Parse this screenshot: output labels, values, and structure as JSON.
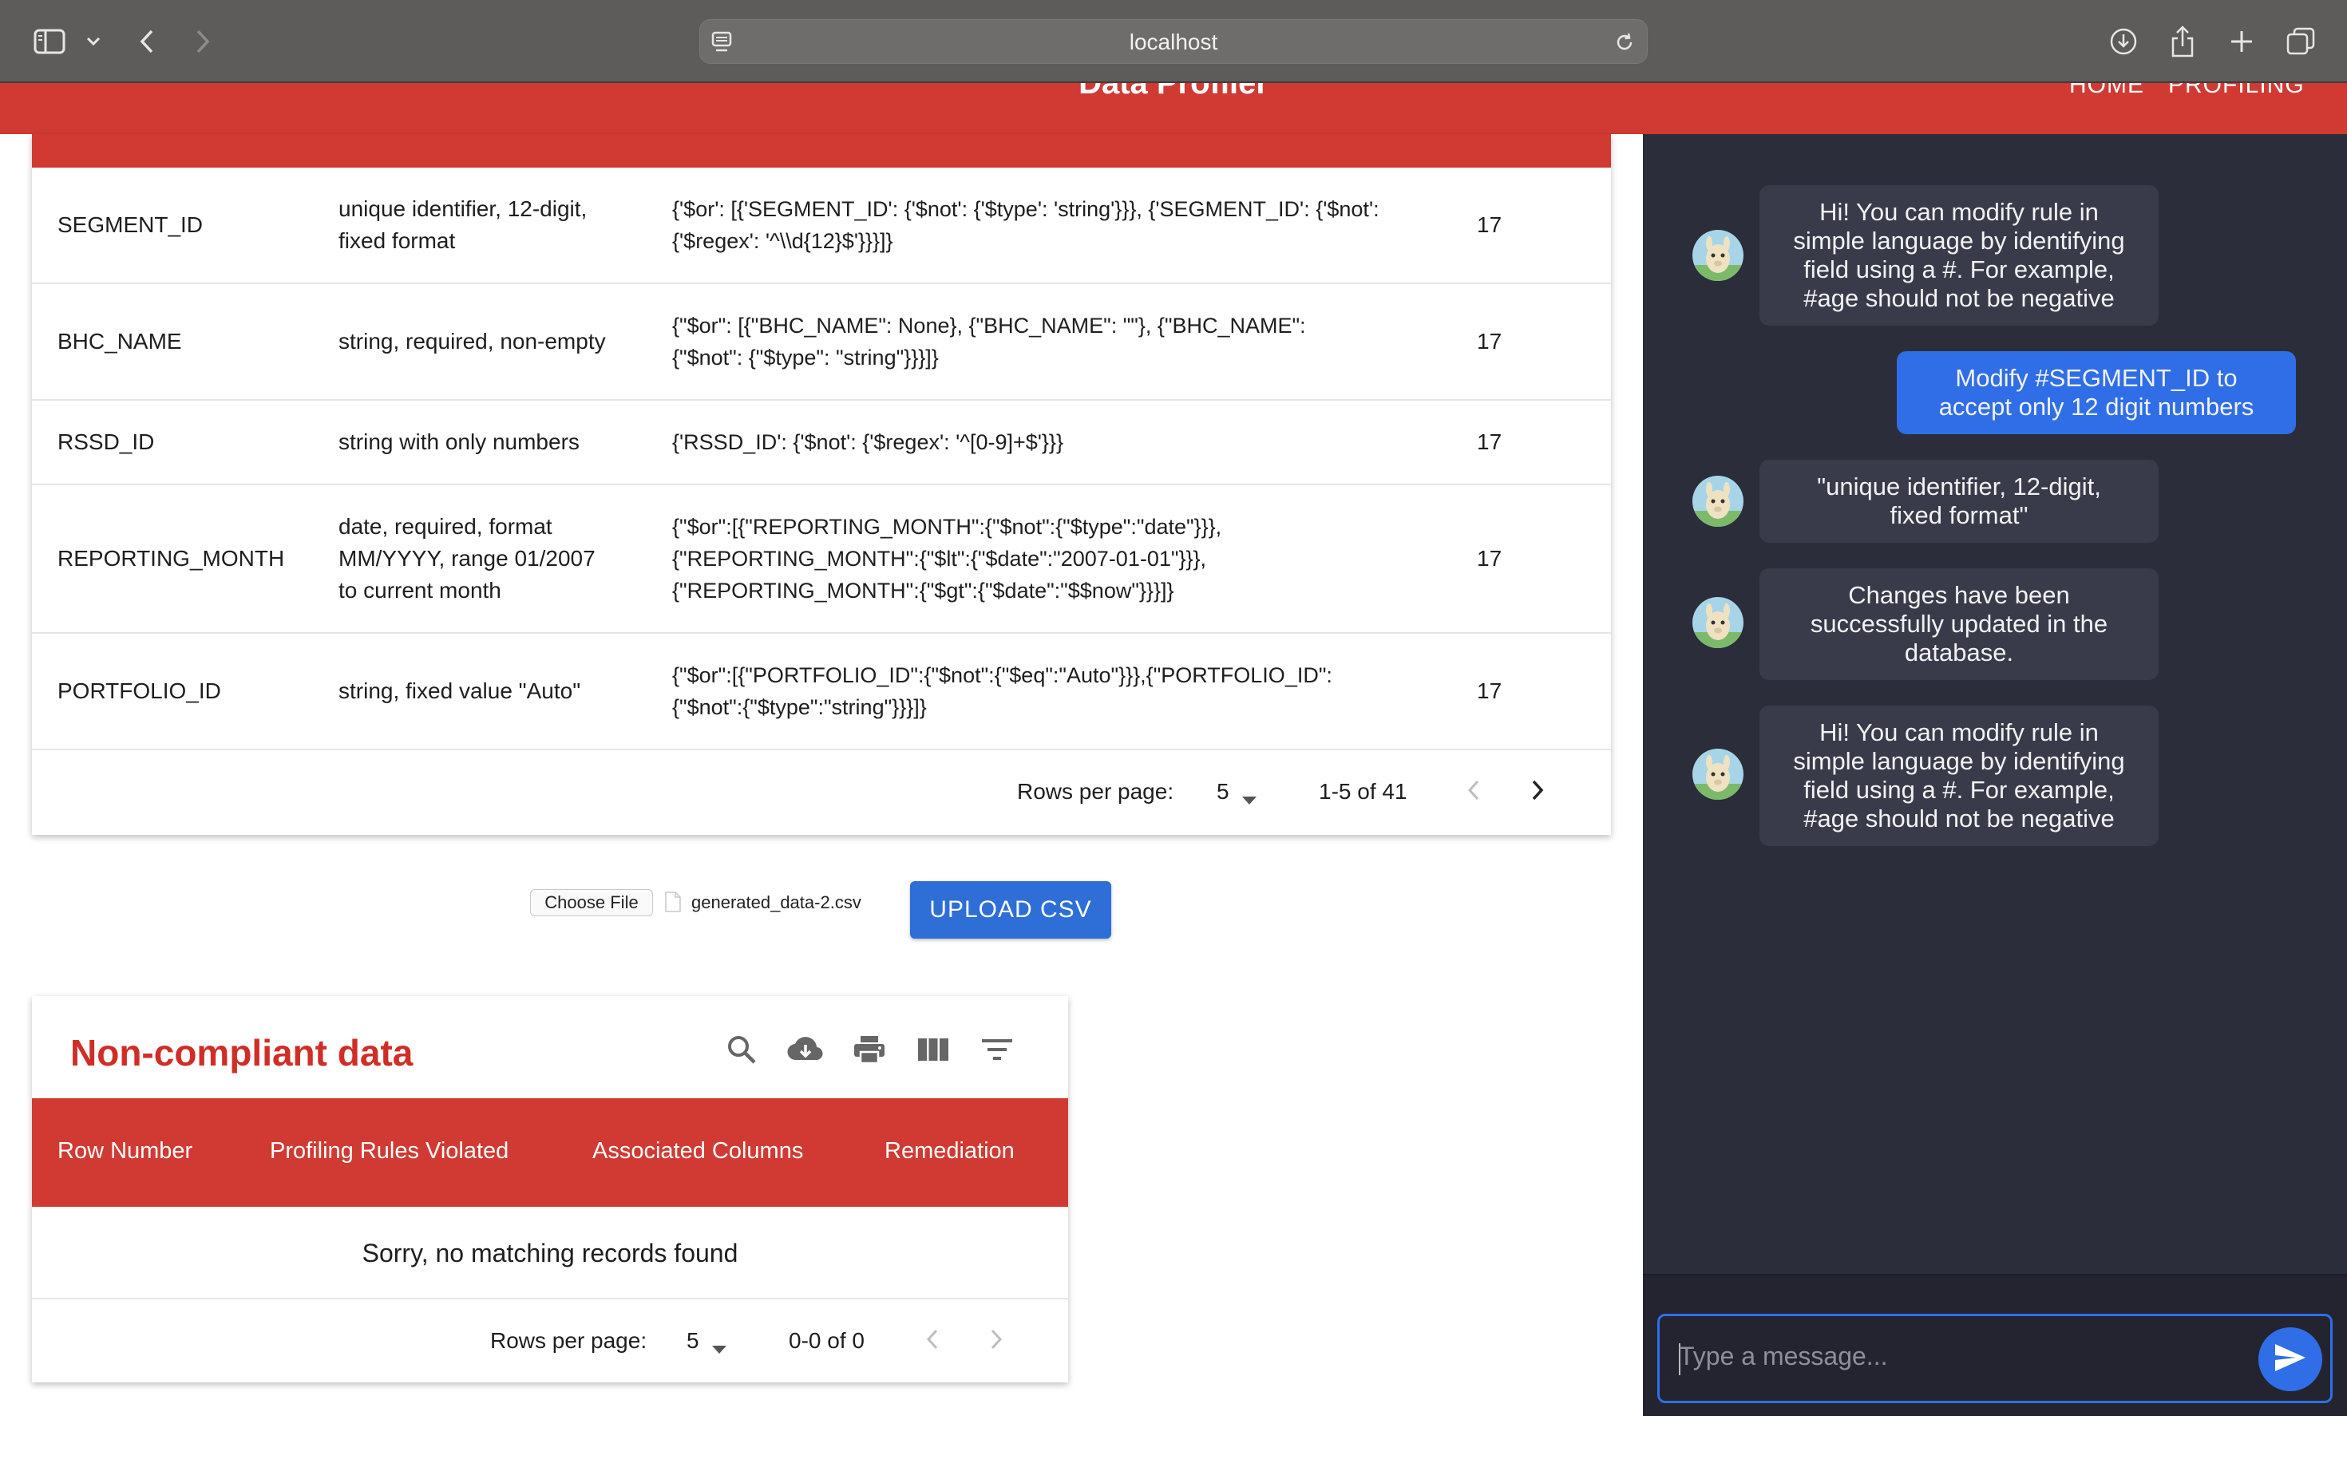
{
  "browser": {
    "url": "localhost"
  },
  "header": {
    "title": "Data Profiler",
    "nav": [
      "HOME",
      "PROFILING"
    ]
  },
  "rules_table": {
    "rows": [
      {
        "field": "SEGMENT_ID",
        "description": [
          "unique identifier, 12-digit,",
          "fixed format"
        ],
        "rule": [
          "{'$or': [{'SEGMENT_ID': {'$not': {'$type': 'string'}}}, {'SEGMENT_ID': {'$not':",
          "{'$regex': '^\\\\d{12}$'}}}]}"
        ],
        "count": "17"
      },
      {
        "field": "BHC_NAME",
        "description": [
          "string, required, non-empty"
        ],
        "rule": [
          "{\"$or\": [{\"BHC_NAME\": None}, {\"BHC_NAME\": \"\"}, {\"BHC_NAME\":",
          "{\"$not\": {\"$type\": \"string\"}}}]}"
        ],
        "count": "17"
      },
      {
        "field": "RSSD_ID",
        "description": [
          "string with only numbers"
        ],
        "rule": [
          "{'RSSD_ID': {'$not': {'$regex': '^[0-9]+$'}}}"
        ],
        "count": "17"
      },
      {
        "field": "REPORTING_MONTH",
        "description": [
          "date, required, format",
          "MM/YYYY, range 01/2007",
          "to current month"
        ],
        "rule": [
          "{\"$or\":[{\"REPORTING_MONTH\":{\"$not\":{\"$type\":\"date\"}}},",
          "{\"REPORTING_MONTH\":{\"$lt\":{\"$date\":\"2007-01-01\"}}},",
          "{\"REPORTING_MONTH\":{\"$gt\":{\"$date\":\"$$now\"}}}]}"
        ],
        "count": "17"
      },
      {
        "field": "PORTFOLIO_ID",
        "description": [
          "string, fixed value \"Auto\""
        ],
        "rule": [
          "{\"$or\":[{\"PORTFOLIO_ID\":{\"$not\":{\"$eq\":\"Auto\"}}},{\"PORTFOLIO_ID\":",
          "{\"$not\":{\"$type\":\"string\"}}}]}"
        ],
        "count": "17"
      }
    ],
    "pagination": {
      "rows_per_page_label": "Rows per page:",
      "rows_per_page": "5",
      "range": "1-5 of 41"
    }
  },
  "upload": {
    "choose_file_label": "Choose File",
    "file_name": "generated_data-2.csv",
    "button_label": "UPLOAD CSV"
  },
  "noncompliant": {
    "title": "Non-compliant data",
    "toolbar_icons": [
      "search-icon",
      "download-icon",
      "print-icon",
      "view-columns-icon",
      "filter-icon"
    ],
    "columns": [
      "Row Number",
      "Profiling Rules Violated",
      "Associated Columns",
      "Remediation"
    ],
    "empty_message": "Sorry, no matching records found",
    "pagination": {
      "rows_per_page_label": "Rows per page:",
      "rows_per_page": "5",
      "range": "0-0 of 0"
    }
  },
  "chat": {
    "messages": [
      {
        "sender": "bot",
        "lines": [
          "Hi! You can modify rule in",
          "simple language by identifying",
          "field using a #. For example,",
          "#age should not be negative"
        ]
      },
      {
        "sender": "user",
        "lines": [
          "Modify #SEGMENT_ID to",
          "accept only 12 digit numbers"
        ]
      },
      {
        "sender": "bot",
        "lines": [
          "\"unique identifier, 12-digit,",
          "fixed format\""
        ]
      },
      {
        "sender": "bot",
        "lines": [
          "Changes have been",
          "successfully updated in the",
          "database."
        ]
      },
      {
        "sender": "bot",
        "lines": [
          "Hi! You can modify rule in",
          "simple language by identifying",
          "field using a #. For example,",
          "#age should not be negative"
        ]
      }
    ],
    "input_placeholder": "Type a message..."
  },
  "colors": {
    "brand_red": "#d03a32",
    "title_red": "#cf2e26",
    "accent_blue": "#2f6ee6",
    "chat_bg": "#2b2d3a"
  }
}
